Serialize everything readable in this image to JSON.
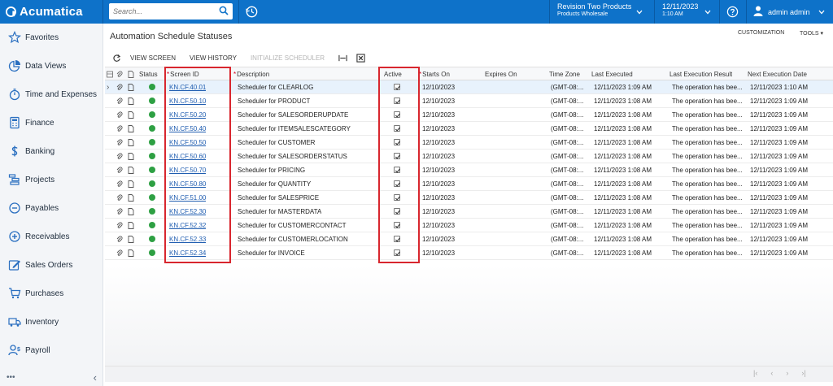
{
  "app": {
    "name": "Acumatica"
  },
  "header": {
    "search_placeholder": "Search...",
    "company_line1": "Revision Two Products",
    "company_line2": "Products Wholesale",
    "date": "12/11/2023",
    "time": "1:10 AM",
    "user": "admin admin"
  },
  "sidebar": {
    "items": [
      {
        "label": "Favorites",
        "icon": "star-icon"
      },
      {
        "label": "Data Views",
        "icon": "pie-chart-icon"
      },
      {
        "label": "Time and Expenses",
        "icon": "stopwatch-icon"
      },
      {
        "label": "Finance",
        "icon": "calculator-icon"
      },
      {
        "label": "Banking",
        "icon": "dollar-icon"
      },
      {
        "label": "Projects",
        "icon": "projects-icon"
      },
      {
        "label": "Payables",
        "icon": "minus-circle-icon"
      },
      {
        "label": "Receivables",
        "icon": "plus-circle-icon"
      },
      {
        "label": "Sales Orders",
        "icon": "edit-icon"
      },
      {
        "label": "Purchases",
        "icon": "cart-icon"
      },
      {
        "label": "Inventory",
        "icon": "truck-icon"
      },
      {
        "label": "Payroll",
        "icon": "payroll-icon"
      }
    ],
    "more": "•••",
    "collapse": "‹"
  },
  "page": {
    "title": "Automation Schedule Statuses",
    "customization": "CUSTOMIZATION",
    "tools": "TOOLS ▾"
  },
  "toolbar": {
    "view_screen": "VIEW SCREEN",
    "view_history": "VIEW HISTORY",
    "initialize_scheduler": "INITIALIZE SCHEDULER"
  },
  "grid": {
    "columns": {
      "status": "Status",
      "screen_id": "Screen ID",
      "description": "Description",
      "active": "Active",
      "starts_on": "Starts On",
      "expires_on": "Expires On",
      "time_zone": "Time Zone",
      "last_executed": "Last Executed",
      "last_result": "Last Execution Result",
      "next_date": "Next Execution Date"
    },
    "rows": [
      {
        "screen_id": "KN.CF.40.01",
        "description": "Scheduler for CLEARLOG",
        "starts_on": "12/10/2023",
        "time_zone": "(GMT-08:...",
        "last_executed": "12/11/2023 1:09 AM",
        "last_result": "The operation has bee...",
        "next": "12/11/2023 1:10 AM"
      },
      {
        "screen_id": "KN.CF.50.10",
        "description": "Scheduler for PRODUCT",
        "starts_on": "12/10/2023",
        "time_zone": "(GMT-08:...",
        "last_executed": "12/11/2023 1:08 AM",
        "last_result": "The operation has bee...",
        "next": "12/11/2023 1:09 AM"
      },
      {
        "screen_id": "KN.CF.50.20",
        "description": "Scheduler for SALESORDERUPDATE",
        "starts_on": "12/10/2023",
        "time_zone": "(GMT-08:...",
        "last_executed": "12/11/2023 1:08 AM",
        "last_result": "The operation has bee...",
        "next": "12/11/2023 1:09 AM"
      },
      {
        "screen_id": "KN.CF.50.40",
        "description": "Scheduler for ITEMSALESCATEGORY",
        "starts_on": "12/10/2023",
        "time_zone": "(GMT-08:...",
        "last_executed": "12/11/2023 1:08 AM",
        "last_result": "The operation has bee...",
        "next": "12/11/2023 1:09 AM"
      },
      {
        "screen_id": "KN.CF.50.50",
        "description": "Scheduler for CUSTOMER",
        "starts_on": "12/10/2023",
        "time_zone": "(GMT-08:...",
        "last_executed": "12/11/2023 1:08 AM",
        "last_result": "The operation has bee...",
        "next": "12/11/2023 1:09 AM"
      },
      {
        "screen_id": "KN.CF.50.60",
        "description": "Scheduler for SALESORDERSTATUS",
        "starts_on": "12/10/2023",
        "time_zone": "(GMT-08:...",
        "last_executed": "12/11/2023 1:08 AM",
        "last_result": "The operation has bee...",
        "next": "12/11/2023 1:09 AM"
      },
      {
        "screen_id": "KN.CF.50.70",
        "description": "Scheduler for PRICING",
        "starts_on": "12/10/2023",
        "time_zone": "(GMT-08:...",
        "last_executed": "12/11/2023 1:08 AM",
        "last_result": "The operation has bee...",
        "next": "12/11/2023 1:09 AM"
      },
      {
        "screen_id": "KN.CF.50.80",
        "description": "Scheduler for QUANTITY",
        "starts_on": "12/10/2023",
        "time_zone": "(GMT-08:...",
        "last_executed": "12/11/2023 1:08 AM",
        "last_result": "The operation has bee...",
        "next": "12/11/2023 1:09 AM"
      },
      {
        "screen_id": "KN.CF.51.00",
        "description": "Scheduler for SALESPRICE",
        "starts_on": "12/10/2023",
        "time_zone": "(GMT-08:...",
        "last_executed": "12/11/2023 1:08 AM",
        "last_result": "The operation has bee...",
        "next": "12/11/2023 1:09 AM"
      },
      {
        "screen_id": "KN.CF.52.30",
        "description": "Scheduler for MASTERDATA",
        "starts_on": "12/10/2023",
        "time_zone": "(GMT-08:...",
        "last_executed": "12/11/2023 1:08 AM",
        "last_result": "The operation has bee...",
        "next": "12/11/2023 1:09 AM"
      },
      {
        "screen_id": "KN.CF.52.32",
        "description": "Scheduler for CUSTOMERCONTACT",
        "starts_on": "12/10/2023",
        "time_zone": "(GMT-08:...",
        "last_executed": "12/11/2023 1:08 AM",
        "last_result": "The operation has bee...",
        "next": "12/11/2023 1:09 AM"
      },
      {
        "screen_id": "KN.CF.52.33",
        "description": "Scheduler for CUSTOMERLOCATION",
        "starts_on": "12/10/2023",
        "time_zone": "(GMT-08:...",
        "last_executed": "12/11/2023 1:08 AM",
        "last_result": "The operation has bee...",
        "next": "12/11/2023 1:09 AM"
      },
      {
        "screen_id": "KN.CF.52.34",
        "description": "Scheduler for INVOICE",
        "starts_on": "12/10/2023",
        "time_zone": "(GMT-08:...",
        "last_executed": "12/11/2023 1:08 AM",
        "last_result": "The operation has bee...",
        "next": "12/11/2023 1:09 AM"
      }
    ]
  },
  "pager": {
    "first": "|‹",
    "prev": "‹",
    "next": "›",
    "last": "›|"
  },
  "colors": {
    "brand": "#0e72c9",
    "highlight": "#d8262e",
    "status_ok": "#2ea043",
    "link": "#1f5db0"
  }
}
